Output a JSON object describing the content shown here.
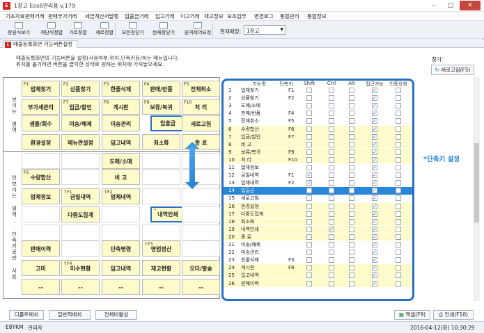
{
  "window": {
    "title": "1창고 Eos8관리용 v.179",
    "app_icon": "E"
  },
  "menu": [
    "기초자료",
    "판매거래",
    "판매부가거래",
    "세금계산서발행",
    "입출금거래",
    "입고거래",
    "이고거래",
    "재고정보",
    "보조업무",
    "변경로그",
    "통합관리",
    "통합정보"
  ],
  "toolbar": {
    "buttons": [
      "창원식보기",
      "계단식정렬",
      "가로정렬",
      "세로정렬",
      "모든창닫기",
      "현재창닫기",
      "원격제어요청"
    ],
    "store_label": "현재매장:",
    "store_value": "1창고"
  },
  "tab": {
    "icon": "E",
    "label": "매출등록화면 기능버튼설정"
  },
  "description": [
    "매출등록화면의 기능버튼을 설정(사용여부,위치,단축키등)하는 메뉴입니다.",
    "위치를 옮기려면 버튼을 클릭한 상태로 원하는 위치에 가져놓으세요."
  ],
  "search": {
    "label": "찾기:",
    "reset_label": "새로고침(F5)"
  },
  "side_labels": {
    "visible": "보이는 영역",
    "hidden": "안보이는 영역. 단축키로만 사용"
  },
  "grid": [
    {
      "label": "업체찾기",
      "hk": "F1",
      "y": true
    },
    {
      "label": "상품찾기",
      "hk": "F2",
      "y": true
    },
    {
      "label": "한줄삭제",
      "hk": "F3",
      "y": true
    },
    {
      "label": "판매/반품",
      "hk": "F4",
      "y": true
    },
    {
      "label": "전체취소",
      "hk": "F5",
      "y": true
    },
    {
      "label": "부가세관리",
      "hk": "",
      "y": true
    },
    {
      "label": "입금/할인",
      "hk": "F7",
      "y": true
    },
    {
      "label": "게시판",
      "hk": "F8",
      "y": true
    },
    {
      "label": "보류/복귀",
      "hk": "F9",
      "y": true
    },
    {
      "label": "처    리",
      "hk": "F10",
      "y": true
    },
    {
      "label": "샘플/회수",
      "hk": "",
      "y": true
    },
    {
      "label": "미송/해제",
      "hk": "",
      "y": true
    },
    {
      "label": "미송관리",
      "hk": "",
      "y": true
    },
    {
      "label": "입출금",
      "hk": "",
      "y": true
    },
    {
      "label": "새로고침",
      "hk": "",
      "y": true
    },
    {
      "label": "환경설정",
      "hk": "",
      "y": true
    },
    {
      "label": "메뉴판설정",
      "hk": "",
      "y": true
    },
    {
      "label": "입고내역",
      "hk": "",
      "y": true
    },
    {
      "label": "최소화",
      "hk": "",
      "y": true
    },
    {
      "label": "종    료",
      "hk": "",
      "y": true
    },
    {
      "label": "",
      "hk": "",
      "y": false
    },
    {
      "label": "",
      "hk": "",
      "y": false
    },
    {
      "label": "도매/소매",
      "hk": "",
      "y": true
    },
    {
      "label": "",
      "hk": "",
      "y": false
    },
    {
      "label": "",
      "hk": "",
      "y": false
    },
    {
      "label": "수량합산",
      "hk": "F6",
      "y": true
    },
    {
      "label": "",
      "hk": "",
      "y": false
    },
    {
      "label": "비    고",
      "hk": "",
      "y": true
    },
    {
      "label": "",
      "hk": "",
      "y": false
    },
    {
      "label": "",
      "hk": "",
      "y": false
    },
    {
      "label": "업체정보",
      "hk": "",
      "y": true
    },
    {
      "label": "금일내역",
      "hk": "↑F1",
      "y": true
    },
    {
      "label": "업체내역",
      "hk": "↑F2",
      "y": true
    },
    {
      "label": "",
      "hk": "",
      "y": false
    },
    {
      "label": "",
      "hk": "",
      "y": false
    },
    {
      "label": "",
      "hk": "",
      "y": false
    },
    {
      "label": "다중도집계",
      "hk": "",
      "y": true
    },
    {
      "label": "",
      "hk": "",
      "y": false
    },
    {
      "label": "내역인쇄",
      "hk": "^",
      "y": true
    },
    {
      "label": "",
      "hk": "",
      "y": false
    },
    {
      "label": "",
      "hk": "",
      "y": false
    },
    {
      "label": "",
      "hk": "",
      "y": false
    },
    {
      "label": "",
      "hk": "",
      "y": false
    },
    {
      "label": "",
      "hk": "",
      "y": false
    },
    {
      "label": "",
      "hk": "",
      "y": false
    },
    {
      "label": "판매이력",
      "hk": "",
      "y": true
    },
    {
      "label": "",
      "hk": "",
      "y": false
    },
    {
      "label": "단축명령",
      "hk": "",
      "y": true
    },
    {
      "label": "영업정산",
      "hk": "↑F3",
      "y": true
    },
    {
      "label": "",
      "hk": "",
      "y": false
    },
    {
      "label": "고미",
      "hk": "",
      "y": true
    },
    {
      "label": "미수현황",
      "hk": "↑F4",
      "y": true
    },
    {
      "label": "입고내역",
      "hk": "",
      "y": true
    },
    {
      "label": "재고현황",
      "hk": "",
      "y": true
    },
    {
      "label": "오더/발송",
      "hk": "",
      "y": true
    },
    {
      "label": "--",
      "hk": "",
      "y": true
    },
    {
      "label": "--",
      "hk": "",
      "y": true
    },
    {
      "label": "--",
      "hk": "",
      "y": true
    },
    {
      "label": "--",
      "hk": "",
      "y": true
    },
    {
      "label": "--",
      "hk": "",
      "y": true
    }
  ],
  "table": {
    "headers": [
      "기능명",
      "단축키",
      "Shift",
      "Ctrl",
      "Alt",
      "접근가능",
      "인증요청"
    ],
    "rows": [
      {
        "n": "1",
        "name": "업체찾기",
        "key": "F1",
        "s": false,
        "c": false,
        "a": false,
        "acc": true,
        "auth": false
      },
      {
        "n": "2",
        "name": "상품찾기",
        "key": "F2",
        "s": false,
        "c": false,
        "a": false,
        "acc": true,
        "auth": false
      },
      {
        "n": "3",
        "name": "도매/소매",
        "key": "",
        "s": false,
        "c": false,
        "a": false,
        "acc": true,
        "auth": false
      },
      {
        "n": "4",
        "name": "판매/반품",
        "key": "F4",
        "s": false,
        "c": false,
        "a": false,
        "acc": true,
        "auth": false
      },
      {
        "n": "5",
        "name": "전체취소",
        "key": "F5",
        "s": false,
        "c": false,
        "a": false,
        "acc": true,
        "auth": false
      },
      {
        "n": "6",
        "name": "수량합산",
        "key": "F6",
        "s": false,
        "c": false,
        "a": false,
        "acc": true,
        "auth": false
      },
      {
        "n": "7",
        "name": "입금/할인",
        "key": "F7",
        "s": false,
        "c": false,
        "a": false,
        "acc": true,
        "auth": false
      },
      {
        "n": "8",
        "name": "비    고",
        "key": "",
        "s": false,
        "c": false,
        "a": false,
        "acc": true,
        "auth": false
      },
      {
        "n": "9",
        "name": "보류/복귀",
        "key": "F9",
        "s": false,
        "c": false,
        "a": false,
        "acc": true,
        "auth": false
      },
      {
        "n": "10",
        "name": "처    리",
        "key": "F10",
        "s": false,
        "c": false,
        "a": false,
        "acc": true,
        "auth": false
      },
      {
        "n": "11",
        "name": "업체정보",
        "key": "",
        "s": false,
        "c": false,
        "a": false,
        "acc": true,
        "auth": false
      },
      {
        "n": "12",
        "name": "금일내역",
        "key": "F1",
        "s": true,
        "c": false,
        "a": false,
        "acc": true,
        "auth": false
      },
      {
        "n": "13",
        "name": "업체내역",
        "key": "F2",
        "s": true,
        "c": false,
        "a": false,
        "acc": true,
        "auth": false
      },
      {
        "n": "14",
        "name": "입출금",
        "key": "",
        "s": false,
        "c": false,
        "a": false,
        "acc": true,
        "auth": false
      },
      {
        "n": "15",
        "name": "새로고침",
        "key": "",
        "s": false,
        "c": false,
        "a": false,
        "acc": true,
        "auth": false
      },
      {
        "n": "16",
        "name": "환경설정",
        "key": "",
        "s": false,
        "c": false,
        "a": false,
        "acc": true,
        "auth": false
      },
      {
        "n": "17",
        "name": "다중도집계",
        "key": "",
        "s": false,
        "c": false,
        "a": false,
        "acc": true,
        "auth": false
      },
      {
        "n": "18",
        "name": "최소화",
        "key": "",
        "s": false,
        "c": false,
        "a": false,
        "acc": true,
        "auth": false
      },
      {
        "n": "19",
        "name": "내역인쇄",
        "key": "",
        "s": false,
        "c": true,
        "a": false,
        "acc": true,
        "auth": false
      },
      {
        "n": "20",
        "name": "종    료",
        "key": "",
        "s": false,
        "c": false,
        "a": false,
        "acc": true,
        "auth": false
      },
      {
        "n": "21",
        "name": "미송/해제",
        "key": "",
        "s": false,
        "c": false,
        "a": false,
        "acc": true,
        "auth": false
      },
      {
        "n": "22",
        "name": "미송관리",
        "key": "",
        "s": false,
        "c": false,
        "a": false,
        "acc": true,
        "auth": false
      },
      {
        "n": "23",
        "name": "한줄삭제",
        "key": "F3",
        "s": false,
        "c": false,
        "a": false,
        "acc": true,
        "auth": false
      },
      {
        "n": "24",
        "name": "게시판",
        "key": "F8",
        "s": false,
        "c": false,
        "a": false,
        "acc": true,
        "auth": false
      },
      {
        "n": "25",
        "name": "입고내역",
        "key": "",
        "s": false,
        "c": false,
        "a": false,
        "acc": true,
        "auth": false
      },
      {
        "n": "26",
        "name": "판매이력",
        "key": "",
        "s": false,
        "c": false,
        "a": false,
        "acc": true,
        "auth": false
      }
    ]
  },
  "annotation": "*단축키 설정",
  "bottom": {
    "left_buttons": [
      "디폴트배치",
      "일반적배치",
      "전체비활성"
    ],
    "excel_label": "엑셀(F9)",
    "print_label": "인쇄(F10)"
  },
  "status": {
    "left1": "E8YKM",
    "left2": "관리자",
    "right": "2016-04-12(화) 10:30:29"
  }
}
